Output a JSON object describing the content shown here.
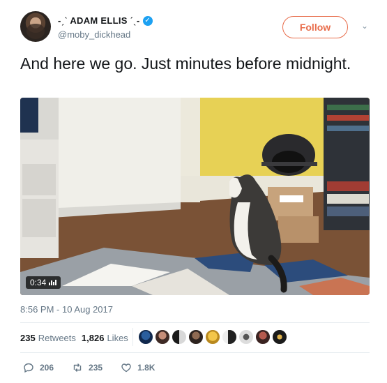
{
  "author": {
    "display_name": "-ˏˋ ADAM ELLIS ˊˎ-",
    "handle": "@moby_dickhead",
    "verified_icon": "verified-check-icon"
  },
  "follow_button": {
    "label": "Follow"
  },
  "tweet": {
    "text": "And here we go. Just minutes before midnight."
  },
  "video": {
    "duration": "0:34"
  },
  "timestamp": "8:56 PM - 10 Aug 2017",
  "stats": {
    "retweets_count": "235",
    "retweets_label": "Retweets",
    "likes_count": "1,826",
    "likes_label": "Likes"
  },
  "actions": {
    "reply_count": "206",
    "retweet_count": "235",
    "like_count": "1.8K"
  },
  "colors": {
    "accent": "#e86c4a",
    "verified": "#1da1f2",
    "secondary_text": "#657786"
  }
}
